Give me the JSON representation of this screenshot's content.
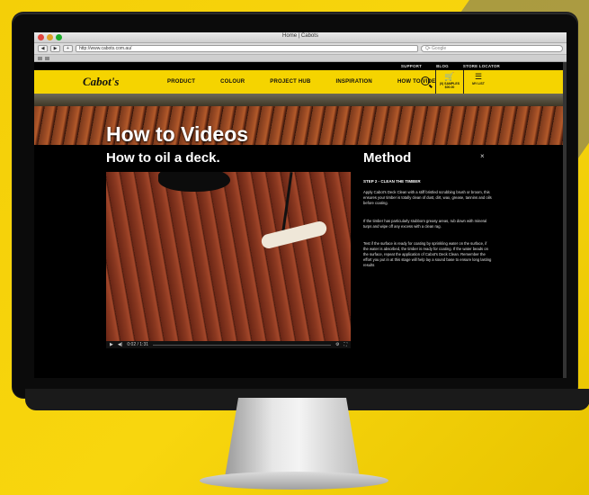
{
  "window": {
    "title": "Home | Cabots"
  },
  "browser": {
    "back": "◀",
    "forward": "▶",
    "reload": "+",
    "url": "http://www.cabots.com.au/",
    "search_placeholder": "Q• Google"
  },
  "utility_nav": [
    "SUPPORT",
    "BLOG",
    "STORE LOCATOR"
  ],
  "brand": "Cabot's",
  "nav": [
    "PRODUCT",
    "COLOUR",
    "PROJECT HUB",
    "INSPIRATION",
    "HOW TO VIDEOS"
  ],
  "cart": {
    "label": "(0) SAMPLES",
    "sub": "$00.00"
  },
  "mylist": {
    "label": "MY LIST"
  },
  "hero": {
    "title": "How to Videos"
  },
  "video": {
    "title": "How to oil a deck.",
    "time": "0:02 / 1:31"
  },
  "method": {
    "title": "Method",
    "close": "×",
    "step": "STEP 2 - CLEAN THE TIMBER",
    "paragraphs": [
      "Apply Cabot's Deck Clean with a stiff bristled scrubbing brush or broom, this ensures your timber is totally clean of dust, dirt, wax, grease, tannins and oils before coating.",
      "If the timber has particularly stubborn greasy areas, rub down with mineral turps and wipe off any excess with a clean rag.",
      "Test if the surface is ready for coating by sprinkling water on the surface, if the water is absorbed, the timber is ready for coating. If the water beads on the surface, repeat the application of Cabot's Deck Clean. Remember the effort you put in at this stage will help lay a sound base to ensure long lasting results"
    ]
  },
  "colors": {
    "brand_yellow": "#f5d400",
    "background": "#000000"
  }
}
